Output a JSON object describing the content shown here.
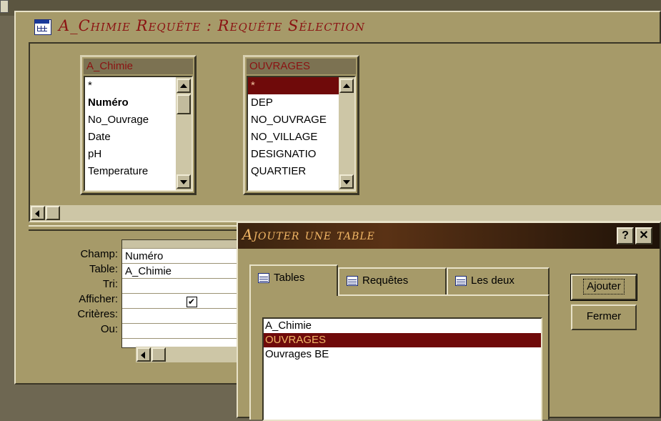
{
  "query_window": {
    "title": "A_Chimie Requête : Requête Sélection"
  },
  "tables": [
    {
      "name": "A_Chimie",
      "fields": [
        "*",
        "Numéro",
        "No_Ouvrage",
        "Date",
        "pH",
        "Temperature"
      ]
    },
    {
      "name": "OUVRAGES",
      "fields": [
        "*",
        "DEP",
        "NO_OUVRAGE",
        "NO_VILLAGE",
        "DESIGNATIO",
        "QUARTIER"
      ]
    }
  ],
  "grid": {
    "row_labels": [
      "Champ:",
      "Table:",
      "Tri:",
      "Afficher:",
      "Critères:",
      "Ou:"
    ],
    "column": {
      "champ": "Numéro",
      "table": "A_Chimie",
      "tri": "",
      "afficher": true,
      "criteres": "",
      "ou": ""
    }
  },
  "dialog": {
    "title": "Ajouter une table",
    "help": "?",
    "close": "✕",
    "tabs": [
      "Tables",
      "Requêtes",
      "Les deux"
    ],
    "active_tab": "Tables",
    "list_items": [
      "A_Chimie",
      "OUVRAGES",
      "Ouvrages BE"
    ],
    "selected_item": "OUVRAGES",
    "buttons": {
      "add": "Ajouter",
      "close": "Fermer"
    }
  },
  "colors": {
    "face": "#a69a69",
    "title_text": "#8b1212",
    "selection": "#6f0a0a",
    "dialog_title_text": "#f2b766"
  }
}
